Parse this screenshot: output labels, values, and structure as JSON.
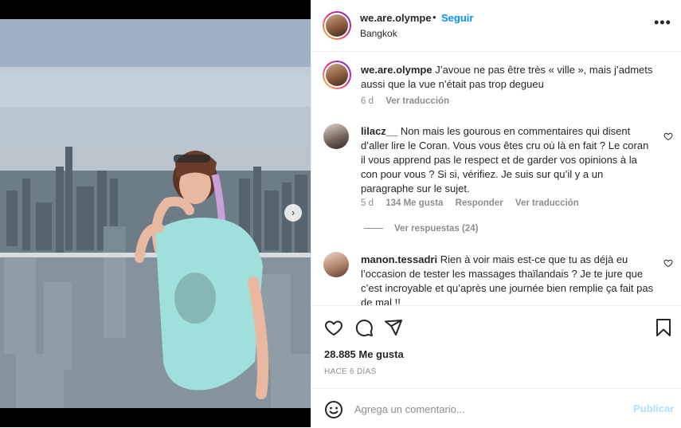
{
  "post": {
    "username": "we.are.olympe",
    "separator": "•",
    "follow_label": "Seguir",
    "location": "Bangkok",
    "more_icon": "more-horizontal-icon"
  },
  "caption": {
    "username": "we.are.olympe",
    "text": "J’avoue ne pas être très « ville », mais j’admets aussi que la vue n’était pas trop degueu",
    "age": "6 d",
    "translate_label": "Ver traducción"
  },
  "comments": [
    {
      "username": "lilacz__",
      "text": "Non mais les gourous en commentaires qui disent d’aller lire le Coran. Vous vous êtes cru où là en fait ? Le coran il vous apprend pas le respect et de garder vos opinions à la con pour vous ? Si si, vérifiez. Je suis sur qu’il y a un paragraphe sur le sujet.",
      "age": "5 d",
      "likes": "134 Me gusta",
      "reply_label": "Responder",
      "translate_label": "Ver traducción",
      "view_replies": "Ver respuestas (24)"
    },
    {
      "username": "manon.tessadri",
      "text": "Rien à voir mais est-ce que tu as déjà eu l’occasion de tester les massages thaïlandais ? Je te jure que c’est incroyable et qu’après une journée bien remplie ça fait pas de mal !!"
    }
  ],
  "actions": {
    "like_icon": "heart-icon",
    "comment_icon": "comment-icon",
    "share_icon": "share-icon",
    "save_icon": "bookmark-icon",
    "likes_count": "28.885 Me gusta",
    "time_ago": "HACE 6 DÍAS"
  },
  "add_comment": {
    "emoji_icon": "emoji-icon",
    "placeholder": "Agrega un comentario...",
    "publish_label": "Publicar"
  },
  "colors": {
    "link_blue": "#0095f6",
    "publish_disabled": "#b2dffc",
    "muted_text": "#8e8e8e"
  }
}
